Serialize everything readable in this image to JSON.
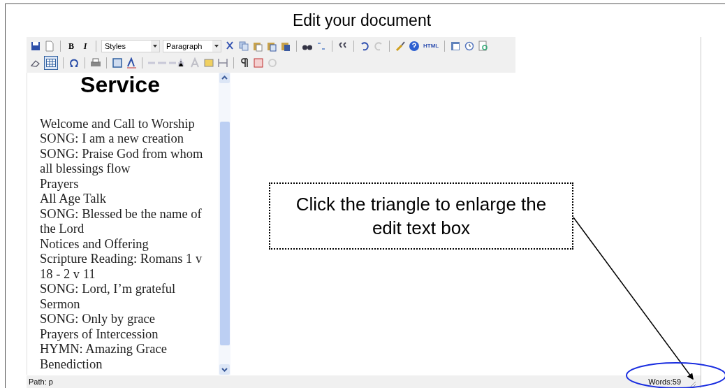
{
  "page_title": "Edit your document",
  "toolbar": {
    "bold_button": "B",
    "italic_button": "I",
    "styles_select": "Styles",
    "format_select": "Paragraph",
    "html_button": "HTML",
    "table_button": {
      "selected": true
    }
  },
  "document": {
    "heading": "Service",
    "lines": [
      "Welcome and Call to Worship",
      "SONG: I am a new creation",
      "SONG: Praise God from whom all blessings flow",
      "Prayers",
      "All Age Talk",
      "SONG: Blessed be the name of the Lord",
      "Notices and Offering",
      "Scripture Reading: Romans 1 v 18 - 2 v 11",
      "SONG: Lord, I’m grateful",
      "Sermon",
      "SONG: Only by grace",
      "Prayers of Intercession",
      "HYMN: Amazing Grace",
      "Benediction"
    ]
  },
  "status_bar": {
    "path": "Path: p",
    "word_count": "Words:59"
  },
  "callout": "Click the triangle to enlarge the edit text box"
}
